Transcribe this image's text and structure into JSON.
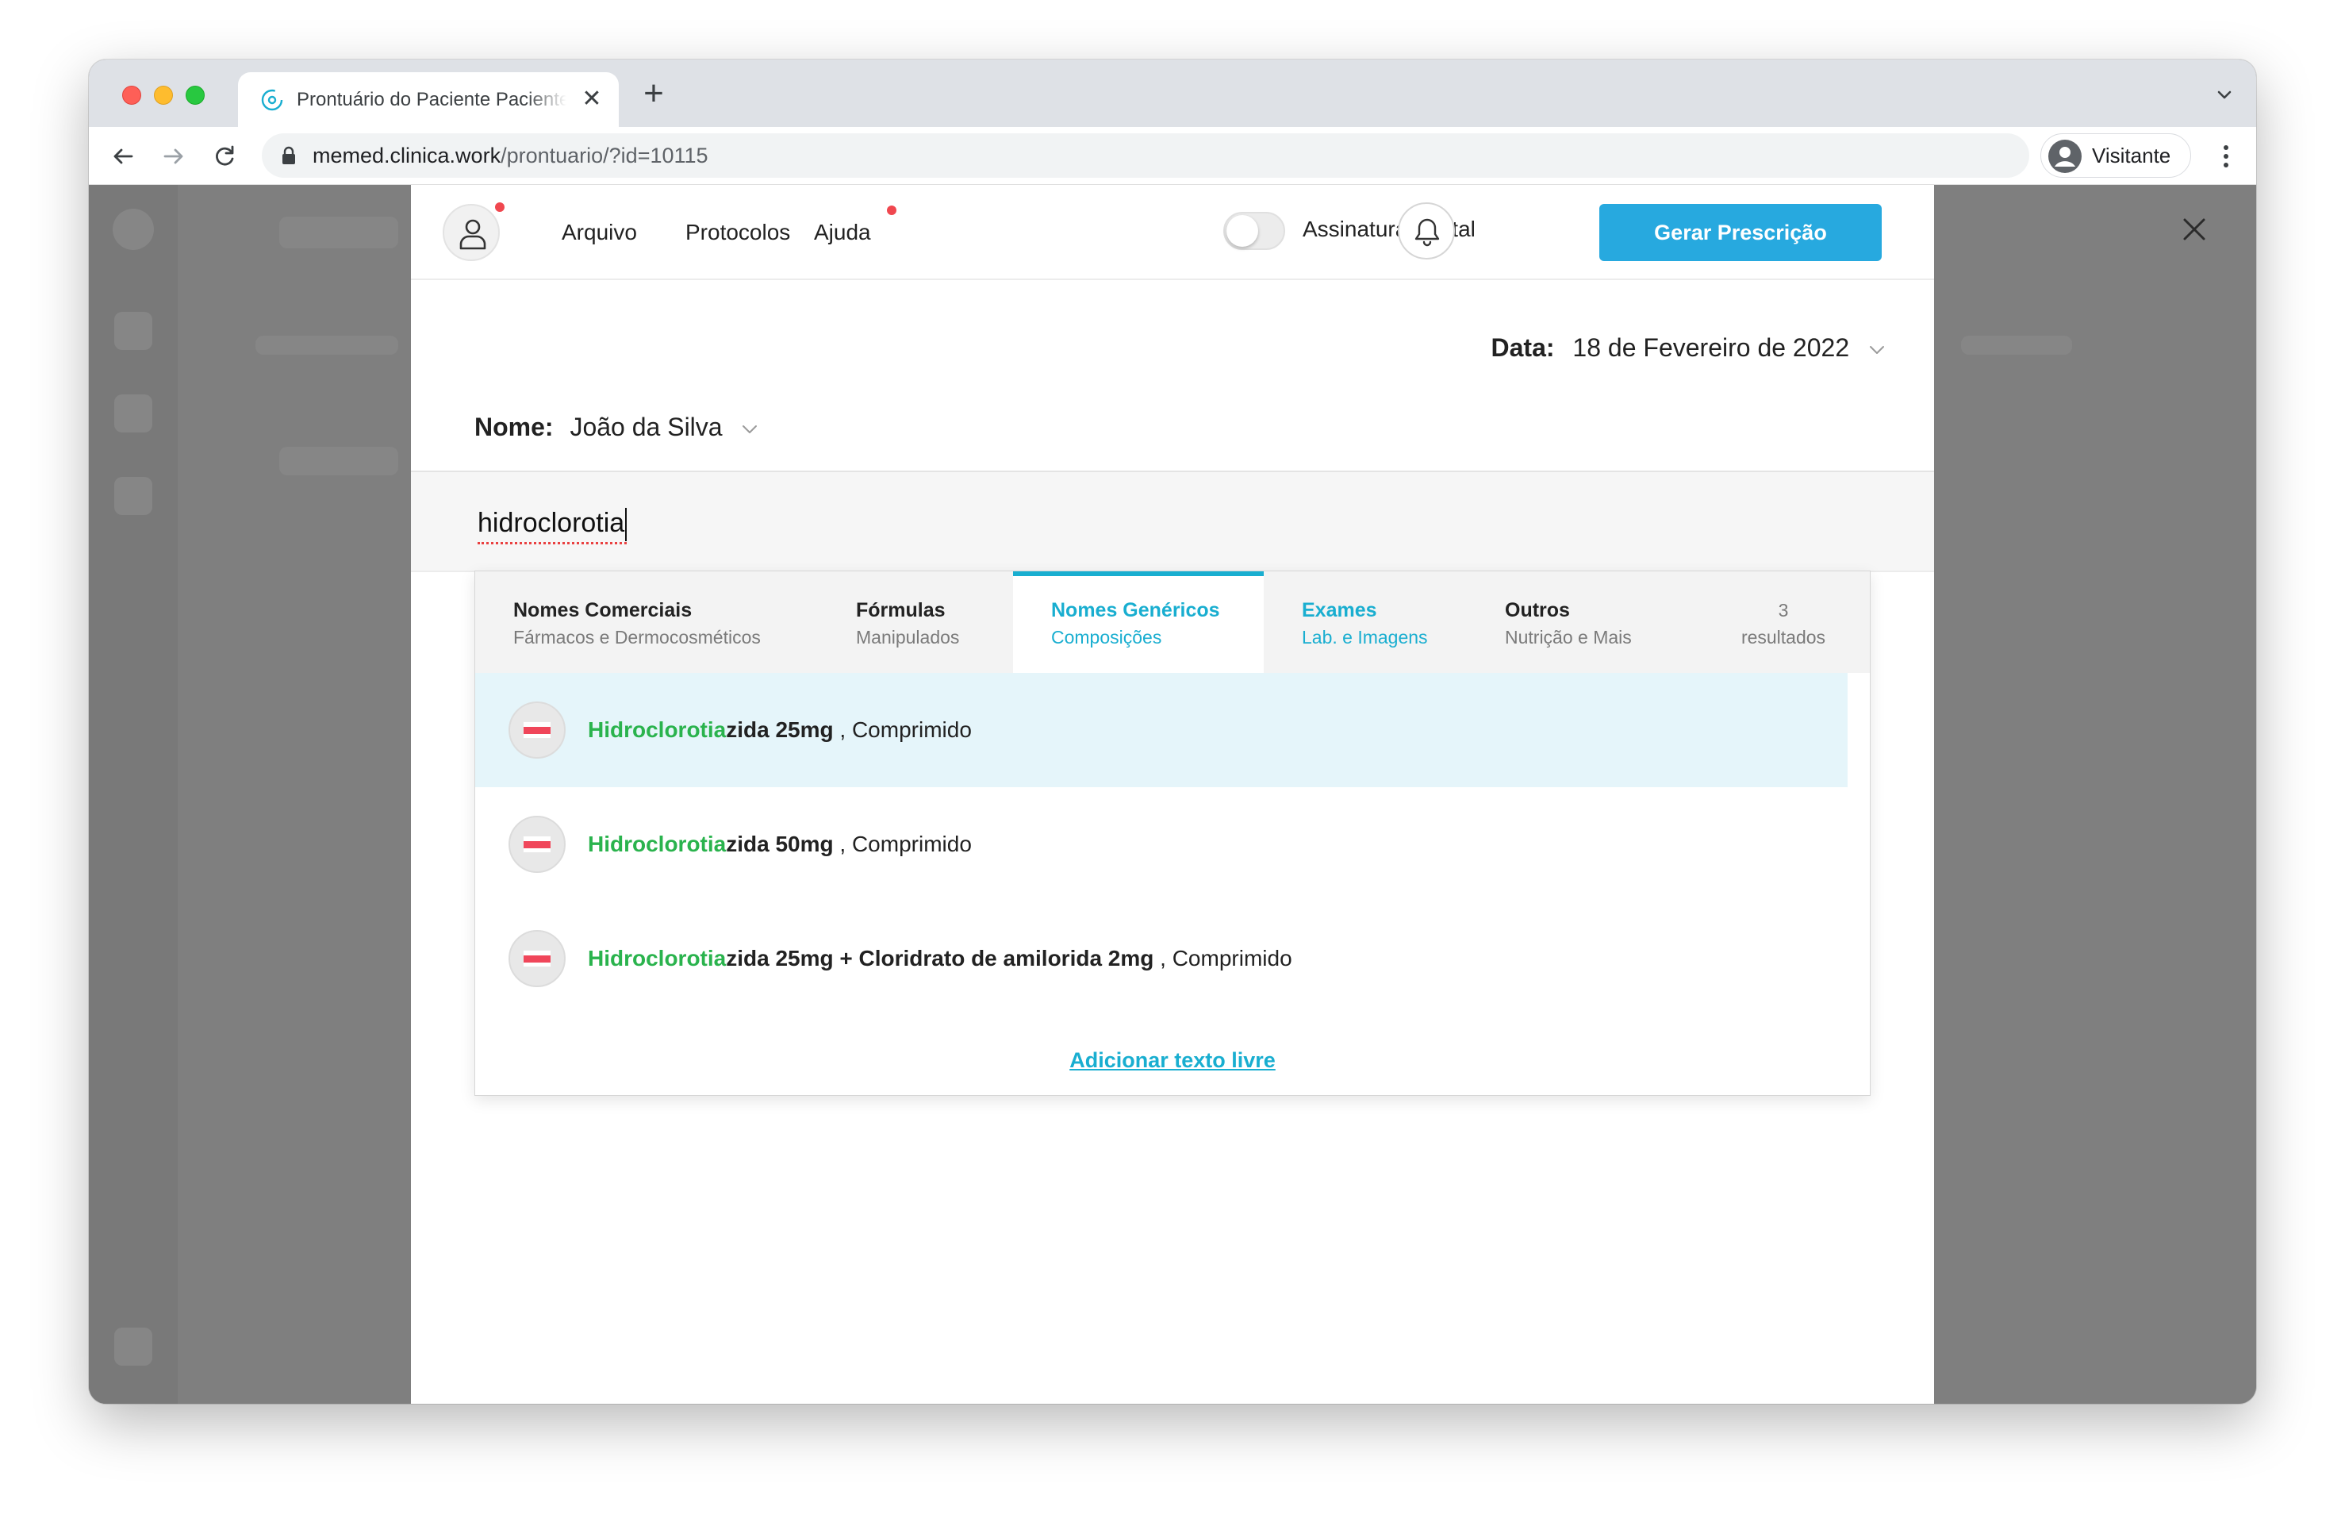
{
  "browser": {
    "tab_title": "Prontuário do Paciente Paciente",
    "url_host": "memed.clinica.work",
    "url_path": "/prontuario/?id=10115",
    "profile_label": "Visitante"
  },
  "header": {
    "menu": {
      "arquivo": "Arquivo",
      "protocolos": "Protocolos",
      "ajuda": "Ajuda"
    },
    "toggle_label": "Assinatura Digital",
    "primary_button": "Gerar Prescrição"
  },
  "form": {
    "date_label": "Data:",
    "date_value": "18 de Fevereiro de 2022",
    "name_label": "Nome:",
    "name_value": "João da Silva",
    "search_value": "hidroclorotia"
  },
  "categories": [
    {
      "title": "Nomes Comerciais",
      "subtitle": "Fármacos e Dermocosméticos"
    },
    {
      "title": "Fórmulas",
      "subtitle": "Manipulados"
    },
    {
      "title": "Nomes Genéricos",
      "subtitle": "Composições"
    },
    {
      "title": "Exames",
      "subtitle": "Lab. e Imagens"
    },
    {
      "title": "Outros",
      "subtitle": "Nutrição e Mais"
    }
  ],
  "result_count": {
    "number": "3",
    "label": "resultados"
  },
  "results": [
    {
      "match": "Hidroclorotia",
      "rest": "zida 25mg",
      "form": " , Comprimido"
    },
    {
      "match": "Hidroclorotia",
      "rest": "zida 50mg",
      "form": " , Comprimido"
    },
    {
      "match": "Hidroclorotia",
      "rest": "zida 25mg + Cloridrato de amilorida 2mg",
      "form": " , Comprimido"
    }
  ],
  "free_text_link": "Adicionar texto livre",
  "colors": {
    "accent": "#19aed0",
    "button": "#27a9df",
    "match": "#2ab34d",
    "notification": "#f0474f",
    "highlight_row": "#e5f5fa"
  },
  "icons": [
    "user-icon",
    "bell-icon",
    "pill-icon",
    "close-icon",
    "chevron-down-icon",
    "lock-icon"
  ]
}
